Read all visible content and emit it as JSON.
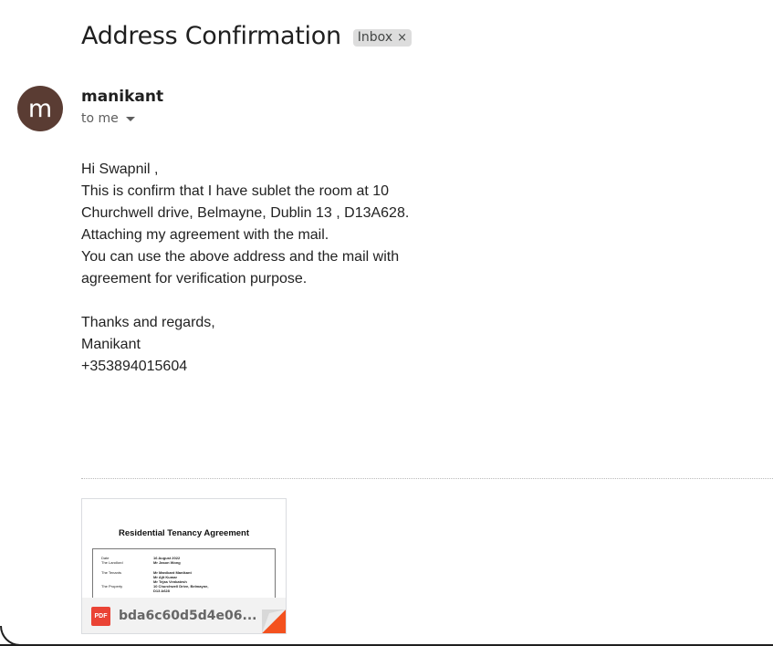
{
  "email": {
    "subject": "Address Confirmation",
    "label": "Inbox",
    "label_remove_glyph": "×",
    "sender": {
      "avatar_letter": "m",
      "avatar_color": "#5a3c33",
      "name": "manikant",
      "recipients": "to me",
      "recipients_icon": "chevron-down-icon"
    },
    "body_lines": [
      "Hi Swapnil ,",
      "This is confirm that I have sublet the room at 10",
      "Churchwell drive, Belmayne, Dublin 13 , D13A628.",
      "Attaching my agreement with the mail.",
      "You can use the above address and the mail with",
      "agreement for verification purpose.",
      "",
      "Thanks and regards,",
      "Manikant",
      "+353894015604"
    ]
  },
  "attachment": {
    "type_badge": "PDF",
    "badge_color": "#ea4335",
    "file_name": "bda6c60d5d4e06...",
    "preview": {
      "title": "Residential Tenancy Agreement",
      "rows": [
        {
          "key": "Date",
          "value": "16 August 2022"
        },
        {
          "key": "The Landlord",
          "value": "Mr Jason Wong"
        },
        {
          "key": "",
          "value": ""
        },
        {
          "key": "The Tenants",
          "value": "Mr Manikant Manikant"
        },
        {
          "key": "",
          "value": "Mr Ajit Kumar"
        },
        {
          "key": "",
          "value": "Mr Tejas Venkatesh"
        },
        {
          "key": "The Property",
          "value": "10 Churchwell Drive, Belmayne,"
        },
        {
          "key": "",
          "value": "D13 A628"
        }
      ]
    }
  }
}
